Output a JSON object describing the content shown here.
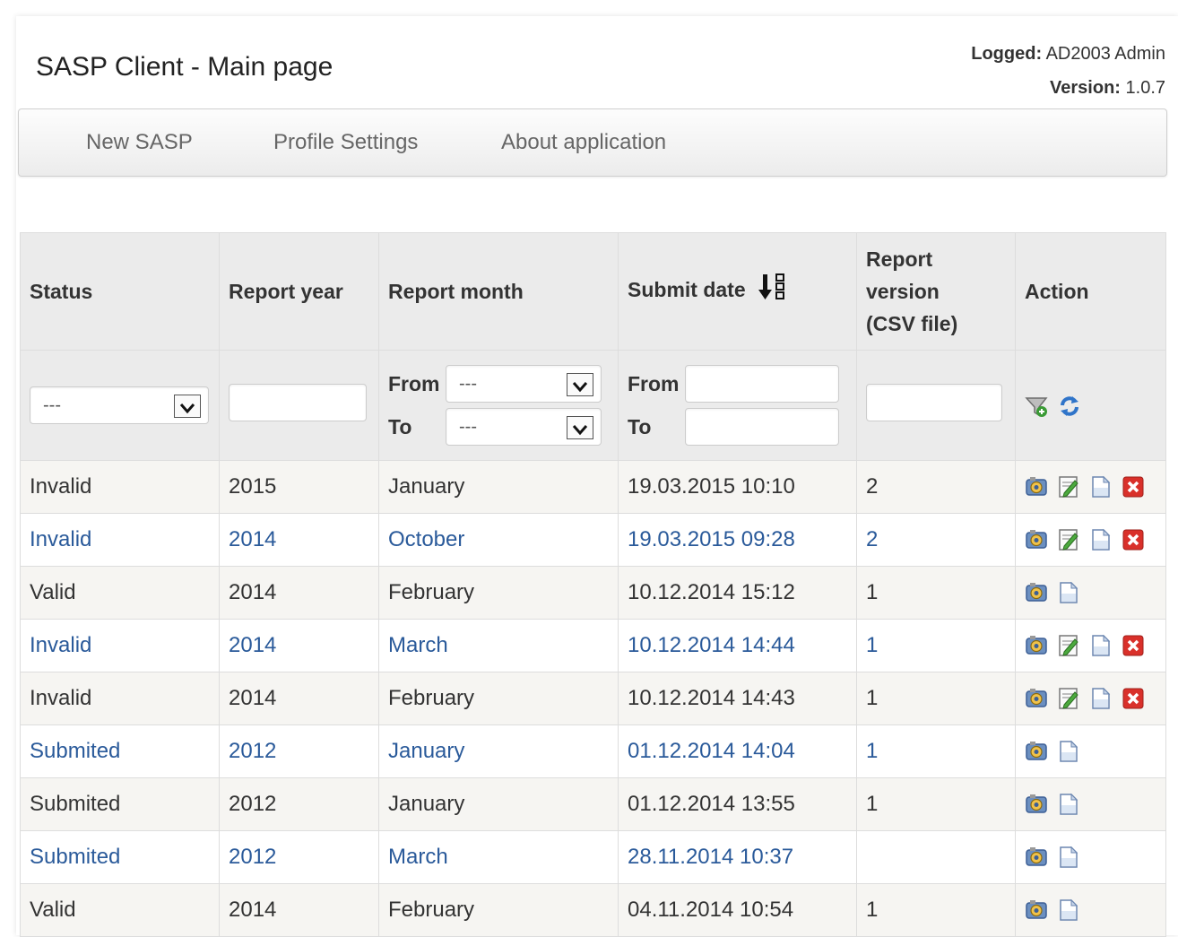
{
  "header": {
    "title": "SASP Client - Main page",
    "logged_label": "Logged:",
    "logged_value": "AD2003 Admin",
    "version_label": "Version:",
    "version_value": "1.0.7"
  },
  "nav": {
    "items": [
      "New SASP",
      "Profile Settings",
      "About application"
    ]
  },
  "table": {
    "columns": {
      "status": "Status",
      "year": "Report year",
      "month": "Report month",
      "submit": "Submit date",
      "version_line1": "Report",
      "version_line2": "version",
      "version_line3": "(CSV file)",
      "action": "Action"
    },
    "filters": {
      "status_selected": "---",
      "from_label": "From",
      "to_label": "To",
      "month_from_selected": "---",
      "month_to_selected": "---"
    },
    "rows": [
      {
        "status": "Invalid",
        "year": "2015",
        "month": "January",
        "submit": "19.03.2015 10:10",
        "version": "2",
        "actions": [
          "view",
          "edit",
          "doc",
          "delete"
        ]
      },
      {
        "status": "Invalid",
        "year": "2014",
        "month": "October",
        "submit": "19.03.2015 09:28",
        "version": "2",
        "actions": [
          "view",
          "edit",
          "doc",
          "delete"
        ]
      },
      {
        "status": "Valid",
        "year": "2014",
        "month": "February",
        "submit": "10.12.2014 15:12",
        "version": "1",
        "actions": [
          "view",
          "doc"
        ]
      },
      {
        "status": "Invalid",
        "year": "2014",
        "month": "March",
        "submit": "10.12.2014 14:44",
        "version": "1",
        "actions": [
          "view",
          "edit",
          "doc",
          "delete"
        ]
      },
      {
        "status": "Invalid",
        "year": "2014",
        "month": "February",
        "submit": "10.12.2014 14:43",
        "version": "1",
        "actions": [
          "view",
          "edit",
          "doc",
          "delete"
        ]
      },
      {
        "status": "Submited",
        "year": "2012",
        "month": "January",
        "submit": "01.12.2014 14:04",
        "version": "1",
        "actions": [
          "view",
          "doc"
        ]
      },
      {
        "status": "Submited",
        "year": "2012",
        "month": "January",
        "submit": "01.12.2014 13:55",
        "version": "1",
        "actions": [
          "view",
          "doc"
        ]
      },
      {
        "status": "Submited",
        "year": "2012",
        "month": "March",
        "submit": "28.11.2014 10:37",
        "version": "",
        "actions": [
          "view",
          "doc"
        ]
      },
      {
        "status": "Valid",
        "year": "2014",
        "month": "February",
        "submit": "04.11.2014 10:54",
        "version": "1",
        "actions": [
          "view",
          "doc"
        ]
      }
    ]
  },
  "colors": {
    "link_blue": "#2a5a9a",
    "header_bg": "#ebebeb",
    "odd_row_bg": "#f6f5f2",
    "delete_red": "#d9302a"
  },
  "icons": {
    "sort": "sort-descending-icon",
    "filter": "filter-add-icon",
    "refresh": "refresh-icon",
    "view": "view-report-icon",
    "edit": "edit-icon",
    "doc": "document-icon",
    "delete": "delete-icon"
  }
}
